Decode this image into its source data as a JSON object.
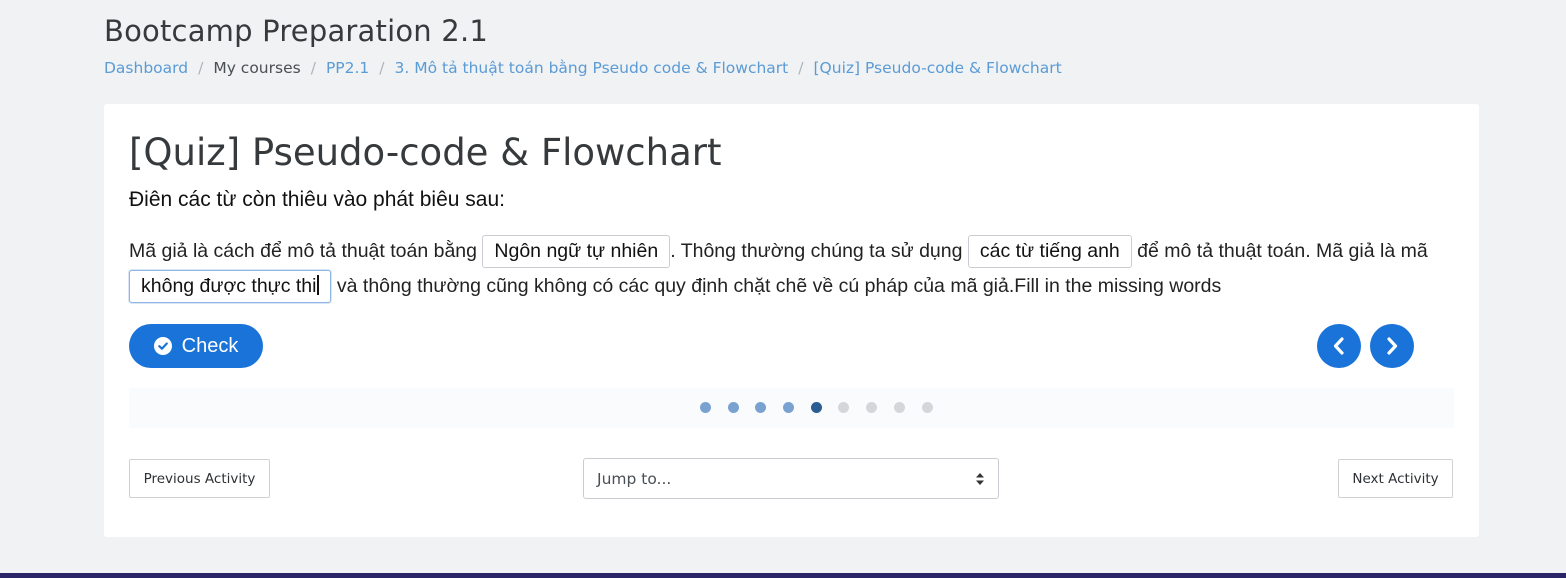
{
  "header": {
    "course_title": "Bootcamp Preparation 2.1",
    "breadcrumb": [
      {
        "label": "Dashboard",
        "link": true
      },
      {
        "label": "My courses",
        "link": false
      },
      {
        "label": "PP2.1",
        "link": true
      },
      {
        "label": "3. Mô tả thuật toán bằng Pseudo code & Flowchart",
        "link": true
      },
      {
        "label": "[Quiz] Pseudo-code & Flowchart",
        "link": true
      }
    ]
  },
  "quiz": {
    "title": "[Quiz] Pseudo-code & Flowchart",
    "instruction": "Điên các từ còn thiêu vào phát biêu sau:",
    "text_1": "Mã giả là cách để mô tả thuật toán bằng ",
    "blank_1": "Ngôn ngữ tự nhiên",
    "text_2": ". Thông thường chúng ta sử dụng ",
    "blank_2": "các từ tiếng anh",
    "text_3": " để mô tả thuật toán. Mã giả là mã ",
    "blank_3": "không được thực thi",
    "text_4": " và thông thường cũng không có các quy định chặt chẽ về cú pháp của mã giả.",
    "text_5": "Fill in the missing words",
    "check_label": "Check",
    "progress": {
      "total": 9,
      "current": 5
    }
  },
  "navigation": {
    "previous_label": "Previous Activity",
    "jump_label": "Jump to...",
    "next_label": "Next Activity"
  },
  "colors": {
    "accent": "#1a73d9",
    "link": "#5b9bd6",
    "footer": "#2a2566"
  },
  "icons": {
    "check": "check-circle-icon",
    "prev": "chevron-left-icon",
    "next": "chevron-right-icon",
    "select": "sort-arrows-icon"
  }
}
